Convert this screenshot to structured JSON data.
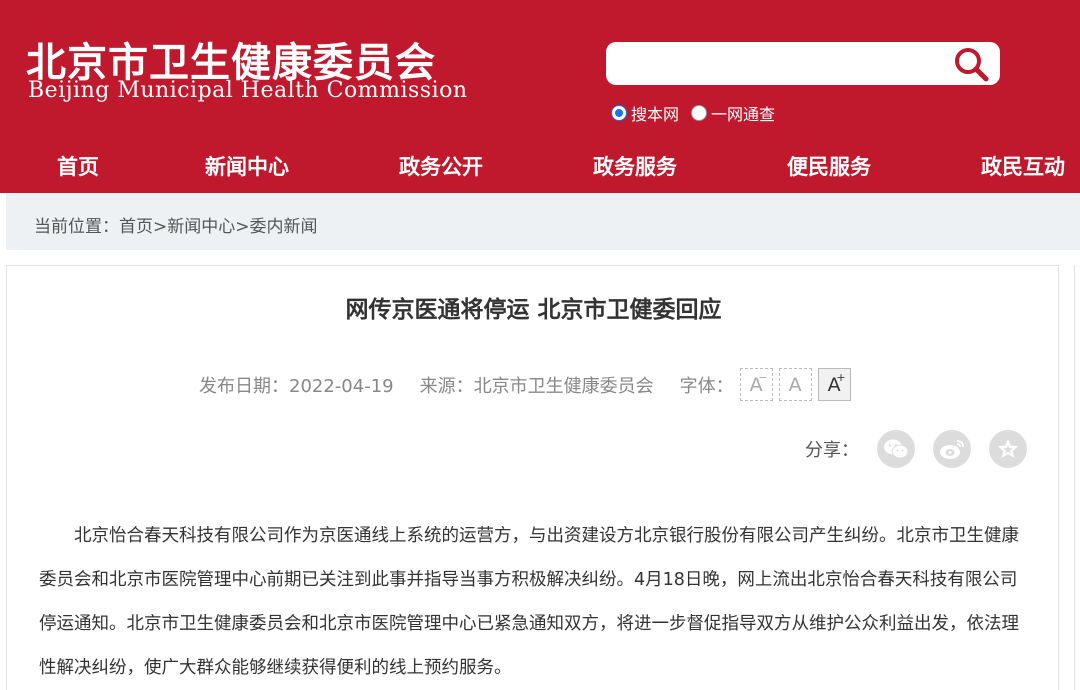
{
  "header": {
    "title_cn": "北京市卫生健康委员会",
    "title_en": "Beijing Municipal Health Commission",
    "search": {
      "value": "",
      "placeholder": "",
      "options": [
        {
          "label": "搜本网",
          "selected": true
        },
        {
          "label": "一网通查",
          "selected": false
        }
      ]
    }
  },
  "nav": {
    "items": [
      {
        "label": "首页"
      },
      {
        "label": "新闻中心"
      },
      {
        "label": "政务公开"
      },
      {
        "label": "政务服务"
      },
      {
        "label": "便民服务"
      },
      {
        "label": "政民互动"
      }
    ]
  },
  "breadcrumb": {
    "prefix": "当前位置：",
    "items": [
      "首页",
      "新闻中心",
      "委内新闻"
    ],
    "separator": ">"
  },
  "article": {
    "title": "网传京医通将停运 北京市卫健委回应",
    "date_label": "发布日期：2022-04-19",
    "source_label": "来源：北京市卫生健康委员会",
    "font_label": "字体：",
    "font_buttons": {
      "small": "A",
      "normal": "A",
      "large": "A"
    },
    "share_label": "分享：",
    "body": "北京怡合春天科技有限公司作为京医通线上系统的运营方，与出资建设方北京银行股份有限公司产生纠纷。北京市卫生健康委员会和北京市医院管理中心前期已关注到此事并指导当事方积极解决纠纷。4月18日晚，网上流出北京怡合春天科技有限公司停运通知。北京市卫生健康委员会和北京市医院管理中心已紧急通知双方，将进一步督促指导双方从维护公众利益出发，依法理性解决纠纷，使广大群众能够继续获得便利的线上预约服务。"
  },
  "colors": {
    "brand_red": "#c0192d",
    "breadcrumb_bg": "#edf1f3",
    "radio_selected": "#1a73e8"
  }
}
